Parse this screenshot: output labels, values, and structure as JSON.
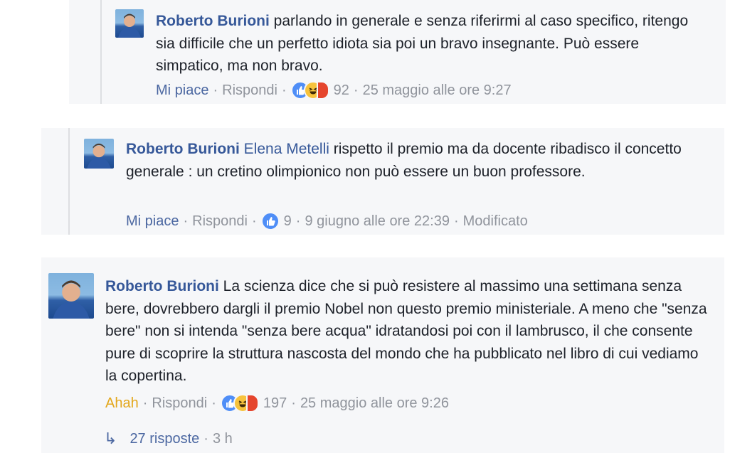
{
  "comments": [
    {
      "author": "Roberto Burioni",
      "mention": "",
      "text": "parlando in generale e senza riferirmi al caso specifico, ritengo sia difficile che un perfetto idiota sia poi un bravo insegnante. Può essere simpatico, ma non bravo.",
      "like_label": "Mi piace",
      "reply_label": "Rispondi",
      "reaction_count": "92",
      "timestamp": "25 maggio alle ore 9:27",
      "extra": ""
    },
    {
      "author": "Roberto Burioni",
      "mention": "Elena Metelli",
      "text": "rispetto il premio ma da docente ribadisco il concetto generale : un cretino olimpionico non può essere un buon professore.",
      "like_label": "Mi piace",
      "reply_label": "Rispondi",
      "reaction_count": "9",
      "timestamp": "9 giugno alle ore 22:39",
      "extra": "Modificato"
    },
    {
      "author": "Roberto Burioni",
      "mention": "",
      "text": "La scienza dice che si può resistere al massimo una settimana senza bere, dovrebbero dargli il premio Nobel non questo premio ministeriale. A meno che \"senza bere\" non si intenda \"senza bere acqua\" idratandosi poi con il lambrusco, il che consente pure di scoprire la struttura nascosta del mondo che ha pubblicato nel libro di cui vediamo la copertina.",
      "like_label": "Ahah",
      "reply_label": "Rispondi",
      "reaction_count": "197",
      "timestamp": "25 maggio alle ore 9:26",
      "extra": "",
      "replies_label": "27 risposte",
      "replies_time": "3 h"
    }
  ],
  "separator": "·",
  "colors": {
    "panel_bg": "#f6f7f9",
    "author": "#365899",
    "text": "#1d2129",
    "meta": "#90949c",
    "like_active": "#4b67a1",
    "haha_active": "#e3a71b"
  },
  "icons": {
    "like": "thumbs-up-icon",
    "haha": "laughing-face-icon",
    "angry": "angry-face-icon",
    "replies": "reply-arrow-icon"
  }
}
